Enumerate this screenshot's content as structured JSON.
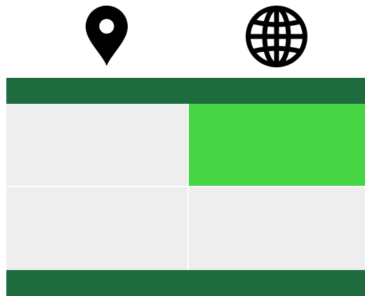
{
  "toolbar": {
    "icons": [
      {
        "name": "map-pin-icon",
        "color": "#000000"
      },
      {
        "name": "globe-icon",
        "color": "#000000"
      }
    ]
  },
  "colors": {
    "bar": "#1e6b3e",
    "cell_default": "#eeeeee",
    "cell_selected": "#46d646",
    "background": "#ffffff"
  },
  "grid": {
    "rows": 2,
    "columns": 2,
    "selected_cell": {
      "row": 1,
      "column": 2
    }
  }
}
